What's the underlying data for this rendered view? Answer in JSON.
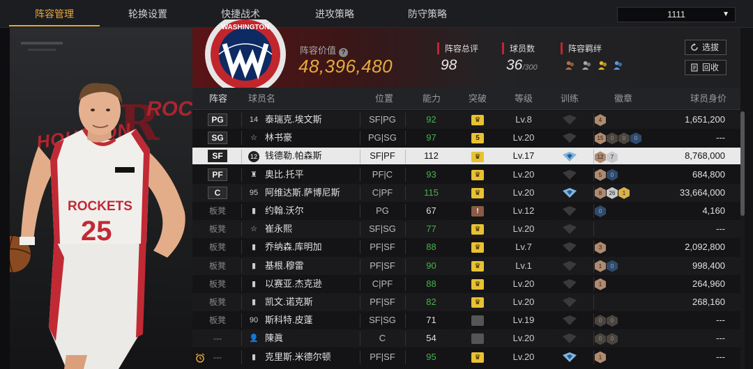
{
  "nav": {
    "tabs": [
      "阵容管理",
      "轮换设置",
      "快捷战术",
      "进攻策略",
      "防守策略"
    ],
    "active_tab": 0,
    "account": "1111"
  },
  "hero": {
    "jersey_team": "ROCKETS",
    "jersey_number": "25",
    "bg_text": "HOUSTON",
    "bg_text_right": "ROCK"
  },
  "team": {
    "logo_text": "WASHINGTON",
    "value_label": "阵容价值",
    "value": "48,396,480",
    "rating_label": "阵容总评",
    "rating": "98",
    "players_label": "球员数",
    "players": "36",
    "players_max": "/300",
    "bond_label": "阵容羁绊",
    "select_button": "选拔",
    "recycle_button": "回收"
  },
  "table": {
    "headers": [
      "阵容",
      "球员名",
      "位置",
      "能力",
      "突破",
      "等级",
      "训练",
      "徽章",
      "球员身价"
    ],
    "rows": [
      {
        "slot": "PG",
        "starter": true,
        "jicon": "14",
        "jtype": "num",
        "name": "泰瑞克.埃文斯",
        "pos": "SF|PG",
        "ability": "92",
        "green": true,
        "brk": "gold",
        "brk_text": "♛",
        "level": "Lv.8",
        "train": "dark",
        "badges": [
          [
            "br",
            "4"
          ]
        ],
        "salary": "1,651,200"
      },
      {
        "slot": "SG",
        "starter": true,
        "jicon": "☆",
        "jtype": "star",
        "name": "林书豪",
        "pos": "PG|SG",
        "ability": "97",
        "green": true,
        "brk": "gold",
        "brk_text": "5",
        "level": "Lv.20",
        "train": "dark",
        "badges": [
          [
            "br",
            "15"
          ],
          [
            "dk",
            "0"
          ],
          [
            "dk",
            "0"
          ],
          [
            "bl",
            "0"
          ]
        ],
        "salary": "---"
      },
      {
        "slot": "SF",
        "starter": true,
        "jicon": "12",
        "jtype": "circle",
        "name": "钱德勒.帕森斯",
        "pos": "SF|PF",
        "ability": "112",
        "green": false,
        "brk": "gold",
        "brk_text": "♛",
        "level": "Lv.17",
        "train": "blue",
        "badges": [
          [
            "br",
            "12"
          ],
          [
            "si",
            "7"
          ]
        ],
        "salary": "8,768,000",
        "selected": true
      },
      {
        "slot": "PF",
        "starter": true,
        "jicon": "♜",
        "jtype": "icon",
        "name": "奥比.托平",
        "pos": "PF|C",
        "ability": "93",
        "green": true,
        "brk": "gold",
        "brk_text": "♛",
        "level": "Lv.20",
        "train": "dark",
        "badges": [
          [
            "br",
            "5"
          ],
          [
            "bl",
            "0"
          ]
        ],
        "salary": "684,800"
      },
      {
        "slot": "C",
        "starter": true,
        "jicon": "95",
        "jtype": "num",
        "name": "阿维达斯.萨博尼斯",
        "pos": "C|PF",
        "ability": "115",
        "green": true,
        "brk": "gold",
        "brk_text": "♛",
        "level": "Lv.20",
        "train": "blue",
        "badges": [
          [
            "br",
            "8"
          ],
          [
            "si",
            "26"
          ],
          [
            "go",
            "1"
          ]
        ],
        "salary": "33,664,000"
      },
      {
        "slot": "板凳",
        "starter": false,
        "jicon": "▮",
        "jtype": "icon",
        "name": "约翰.沃尔",
        "pos": "PG",
        "ability": "67",
        "green": false,
        "brk": "brown",
        "brk_text": "!",
        "level": "Lv.12",
        "train": "dark",
        "badges": [
          [
            "bl",
            "0"
          ]
        ],
        "salary": "4,160"
      },
      {
        "slot": "板凳",
        "starter": false,
        "jicon": "☆",
        "jtype": "star",
        "name": "崔永熙",
        "pos": "SF|SG",
        "ability": "77",
        "green": true,
        "brk": "gold",
        "brk_text": "♛",
        "level": "Lv.20",
        "train": "dark",
        "badges": [],
        "salary": "---"
      },
      {
        "slot": "板凳",
        "starter": false,
        "jicon": "▮",
        "jtype": "icon",
        "name": "乔纳森.库明加",
        "pos": "PF|SF",
        "ability": "88",
        "green": true,
        "brk": "gold",
        "brk_text": "♛",
        "level": "Lv.7",
        "train": "dark",
        "badges": [
          [
            "br",
            "3"
          ]
        ],
        "salary": "2,092,800"
      },
      {
        "slot": "板凳",
        "starter": false,
        "jicon": "▮",
        "jtype": "icon",
        "name": "基根.穆雷",
        "pos": "PF|SF",
        "ability": "90",
        "green": true,
        "brk": "gold",
        "brk_text": "♛",
        "level": "Lv.1",
        "train": "dark",
        "badges": [
          [
            "br",
            "1"
          ],
          [
            "bl",
            "0"
          ]
        ],
        "salary": "998,400"
      },
      {
        "slot": "板凳",
        "starter": false,
        "jicon": "▮",
        "jtype": "icon",
        "name": "以赛亚.杰克逊",
        "pos": "C|PF",
        "ability": "88",
        "green": true,
        "brk": "gold",
        "brk_text": "♛",
        "level": "Lv.20",
        "train": "dark",
        "badges": [
          [
            "br",
            "1"
          ]
        ],
        "salary": "264,960"
      },
      {
        "slot": "板凳",
        "starter": false,
        "jicon": "▮",
        "jtype": "icon",
        "name": "凯文.诺克斯",
        "pos": "PF|SF",
        "ability": "82",
        "green": true,
        "brk": "gold",
        "brk_text": "♛",
        "level": "Lv.20",
        "train": "dark",
        "badges": [],
        "salary": "268,160"
      },
      {
        "slot": "板凳",
        "starter": false,
        "jicon": "90",
        "jtype": "num",
        "name": "斯科特.皮蓬",
        "pos": "SF|SG",
        "ability": "71",
        "green": false,
        "brk": "dark",
        "brk_text": "",
        "level": "Lv.19",
        "train": "dark",
        "badges": [
          [
            "dk",
            "0"
          ],
          [
            "dk",
            "0"
          ]
        ],
        "salary": "---"
      },
      {
        "slot": "---",
        "starter": false,
        "jicon": "👤",
        "jtype": "icon",
        "name": "陳眞",
        "pos": "C",
        "ability": "54",
        "green": false,
        "brk": "dark",
        "brk_text": "",
        "level": "Lv.20",
        "train": "dark",
        "badges": [
          [
            "dk",
            "0"
          ],
          [
            "dk",
            "0"
          ]
        ],
        "salary": "---"
      },
      {
        "slot": "---",
        "starter": false,
        "jicon": "▮",
        "jtype": "icon",
        "name": "克里斯.米德尔顿",
        "pos": "PF|SF",
        "ability": "95",
        "green": true,
        "brk": "gold",
        "brk_text": "♛",
        "level": "Lv.20",
        "train": "blue",
        "badges": [
          [
            "br",
            "1"
          ]
        ],
        "salary": "---"
      }
    ]
  },
  "colors": {
    "accent": "#e6a93b",
    "red": "#c1262d",
    "green": "#46b34a"
  }
}
